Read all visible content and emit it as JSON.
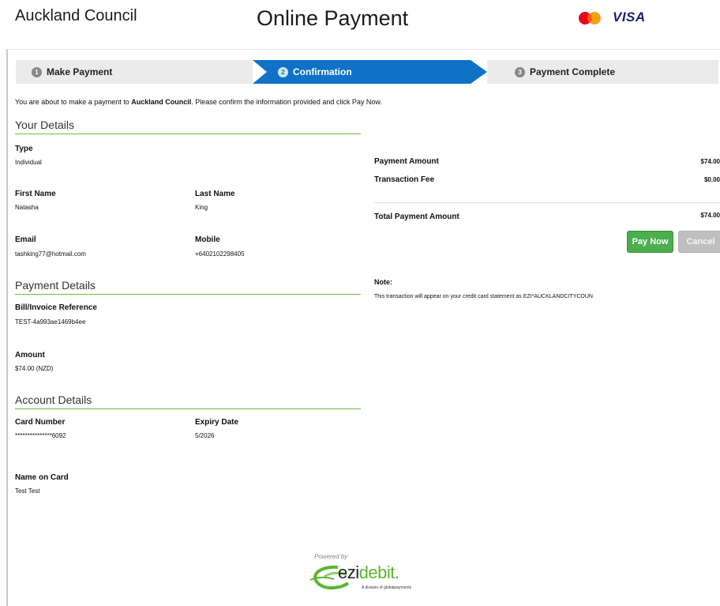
{
  "header": {
    "org_name": "Auckland Council",
    "page_title": "Online Payment",
    "card_brands": [
      "mastercard-icon",
      "VISA"
    ]
  },
  "steps": [
    {
      "num": "1",
      "label": "Make Payment",
      "state": "done"
    },
    {
      "num": "2",
      "label": "Confirmation",
      "state": "active"
    },
    {
      "num": "3",
      "label": "Payment Complete",
      "state": "pending"
    }
  ],
  "intro": {
    "before": "You are about to make a payment to ",
    "payee": "Auckland Council",
    "after": ". Please confirm the information provided and click Pay Now."
  },
  "your_details": {
    "title": "Your Details",
    "type_label": "Type",
    "type_value": "Individual",
    "first_name_label": "First Name",
    "first_name_value": "Natasha",
    "last_name_label": "Last Name",
    "last_name_value": "King",
    "email_label": "Email",
    "email_value": "tashking77@hotmail.com",
    "mobile_label": "Mobile",
    "mobile_value": "+6402102298405"
  },
  "payment_details": {
    "title": "Payment Details",
    "reference_label": "Bill/Invoice Reference",
    "reference_value": "TEST-4a993ae1469b4ee",
    "amount_label": "Amount",
    "amount_value": "$74.00 (NZD)"
  },
  "account_details": {
    "title": "Account Details",
    "card_number_label": "Card Number",
    "card_number_value": "***************6092",
    "expiry_label": "Expiry Date",
    "expiry_value": "5/2026",
    "name_label": "Name on Card",
    "name_value": "Test Test"
  },
  "summary": {
    "payment_amount_label": "Payment Amount",
    "payment_amount_value": "$74.00",
    "fee_label": "Transaction Fee",
    "fee_value": "$0.00",
    "total_label": "Total Payment Amount",
    "total_value": "$74.00"
  },
  "actions": {
    "pay_now": "Pay Now",
    "cancel": "Cancel"
  },
  "note": {
    "label": "Note:",
    "text": "This transaction will appear on your credit card statement as EZI*AUCKLANDCITYCOUN"
  },
  "footer": {
    "powered_by": "Powered by",
    "logo_text_a": "ezi",
    "logo_text_b": "debit",
    "logo_sub": "A division of globalpayments"
  },
  "colors": {
    "active_step": "#0f72c6",
    "section_rule": "#6fbf3f",
    "pay_button": "#4cae4c",
    "cancel_button": "#bfbfbf"
  }
}
